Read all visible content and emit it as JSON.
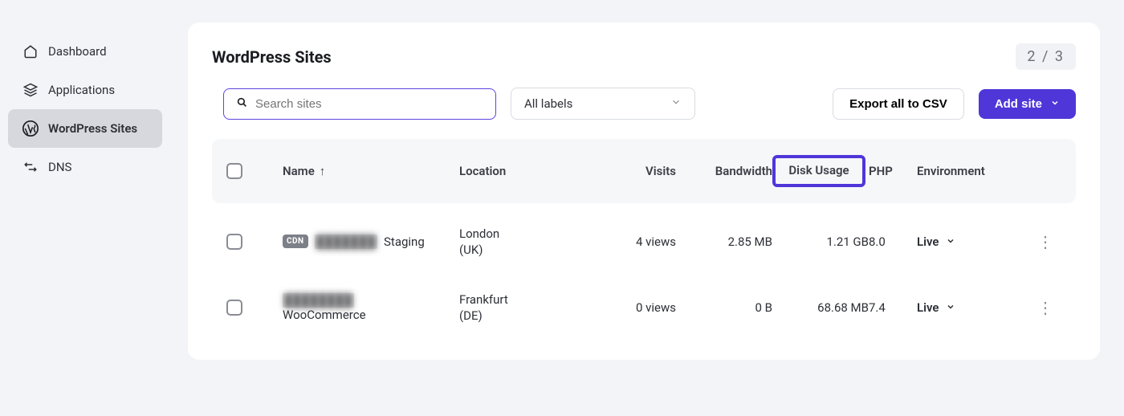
{
  "sidebar": {
    "items": [
      {
        "label": "Dashboard"
      },
      {
        "label": "Applications"
      },
      {
        "label": "WordPress Sites"
      },
      {
        "label": "DNS"
      }
    ]
  },
  "header": {
    "title": "WordPress Sites",
    "pager": "2 / 3"
  },
  "controls": {
    "search_placeholder": "Search sites",
    "labels_select": "All labels",
    "export_label": "Export all to CSV",
    "add_site_label": "Add site"
  },
  "table": {
    "columns": {
      "name": "Name",
      "location": "Location",
      "visits": "Visits",
      "bandwidth": "Bandwidth",
      "disk": "Disk Usage",
      "php": "PHP",
      "environment": "Environment"
    },
    "rows": [
      {
        "cdn": "CDN",
        "name_blurred": "███████",
        "name_suffix": "Staging",
        "location_line1": "London",
        "location_line2": "(UK)",
        "visits": "4 views",
        "bandwidth": "2.85 MB",
        "disk": "1.21 GB",
        "php": "8.0",
        "environment": "Live"
      },
      {
        "cdn": "",
        "name_blurred": "████████",
        "name_suffix": "WooCommerce",
        "location_line1": "Frankfurt",
        "location_line2": "(DE)",
        "visits": "0 views",
        "bandwidth": "0 B",
        "disk": "68.68 MB",
        "php": "7.4",
        "environment": "Live"
      }
    ]
  }
}
